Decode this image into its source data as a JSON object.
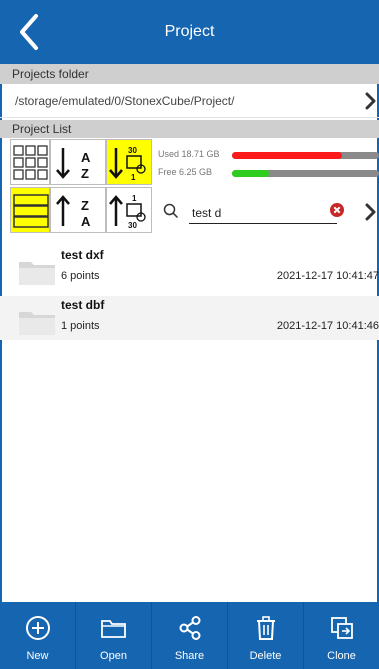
{
  "header": {
    "title": "Project",
    "back_icon": "chevron-left-icon"
  },
  "projects_folder": {
    "label": "Projects folder",
    "path": "/storage/emulated/0/StonexCube/Project/",
    "chevron_icon": "chevron-right-icon"
  },
  "project_list": {
    "label": "Project List",
    "toolbar": {
      "view_grid_icon": "grid-view-icon",
      "sort_name_desc_icon": "sort-a-z-icon",
      "sort_date_desc_icon": "sort-date-desc-icon",
      "view_list_icon": "list-view-icon",
      "sort_name_asc_icon": "sort-z-a-icon",
      "sort_date_asc_icon": "sort-date-asc-icon",
      "selected_color": "#ffff00"
    },
    "storage": {
      "used_label": "Used 18.71 GB",
      "free_label": "Free 6.25 GB",
      "used_fraction": 0.75,
      "free_fraction": 0.25,
      "used_color": "#ff1a1a",
      "free_color": "#2ecc1f"
    },
    "search": {
      "value": "test d",
      "search_icon": "search-icon",
      "clear_icon": "clear-icon"
    }
  },
  "files": [
    {
      "name": "test dxf",
      "points": "6 points",
      "date": "2021-12-17 10:41:47"
    },
    {
      "name": "test dbf",
      "points": "1 points",
      "date": "2021-12-17 10:41:46"
    }
  ],
  "bottom_bar": {
    "buttons": [
      {
        "label": "New",
        "icon": "plus-circle-icon"
      },
      {
        "label": "Open",
        "icon": "folder-open-icon"
      },
      {
        "label": "Share",
        "icon": "share-icon"
      },
      {
        "label": "Delete",
        "icon": "trash-icon"
      },
      {
        "label": "Clone",
        "icon": "clone-icon"
      }
    ]
  },
  "colors": {
    "primary": "#1565b0",
    "section_header": "#cfcfcf"
  }
}
